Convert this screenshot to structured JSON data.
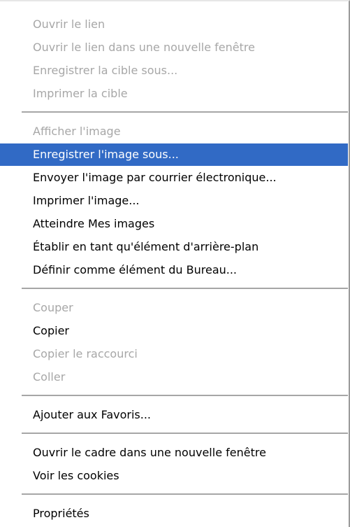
{
  "context_menu": {
    "items": [
      {
        "label": "Ouvrir le lien",
        "state": "disabled"
      },
      {
        "label": "Ouvrir le lien dans une nouvelle fenêtre",
        "state": "disabled"
      },
      {
        "label": "Enregistrer la cible sous...",
        "state": "disabled"
      },
      {
        "label": "Imprimer la cible",
        "state": "disabled"
      },
      {
        "label": "Afficher l'image",
        "state": "disabled"
      },
      {
        "label": "Enregistrer l'image sous...",
        "state": "highlighted"
      },
      {
        "label": "Envoyer l'image par courrier électronique...",
        "state": "enabled"
      },
      {
        "label": "Imprimer l'image...",
        "state": "enabled"
      },
      {
        "label": "Atteindre Mes images",
        "state": "enabled"
      },
      {
        "label": "Établir en tant qu'élément d'arrière-plan",
        "state": "enabled"
      },
      {
        "label": "Définir comme élément du Bureau...",
        "state": "enabled"
      },
      {
        "label": "Couper",
        "state": "disabled"
      },
      {
        "label": "Copier",
        "state": "enabled"
      },
      {
        "label": "Copier le raccourci",
        "state": "disabled"
      },
      {
        "label": "Coller",
        "state": "disabled"
      },
      {
        "label": "Ajouter aux Favoris...",
        "state": "enabled"
      },
      {
        "label": "Ouvrir le cadre dans une nouvelle fenêtre",
        "state": "enabled"
      },
      {
        "label": "Voir les cookies",
        "state": "enabled"
      },
      {
        "label": "Propriétés",
        "state": "enabled"
      }
    ],
    "colors": {
      "highlight_background": "#316ac5",
      "highlight_text": "#ffffff",
      "disabled_text": "#a7a7a7",
      "enabled_text": "#000000",
      "separator": "#a6a6a6"
    }
  }
}
